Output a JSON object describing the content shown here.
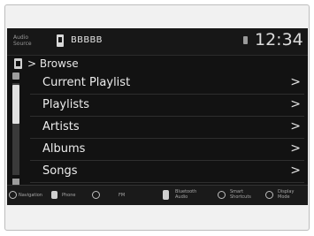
{
  "status": {
    "audio_source_label": "Audio Source",
    "device_name": "BBBBB",
    "clock": "12:34"
  },
  "breadcrumb": {
    "separator": ">",
    "label": "Browse"
  },
  "list": {
    "items": [
      {
        "label": "Current Playlist"
      },
      {
        "label": "Playlists"
      },
      {
        "label": "Artists"
      },
      {
        "label": "Albums"
      },
      {
        "label": "Songs"
      }
    ],
    "chevron": ">"
  },
  "bottom_bar": {
    "items": [
      {
        "label": "Navigation",
        "icon": "navigation-icon"
      },
      {
        "label": "Phone",
        "icon": "phone-icon"
      },
      {
        "label": "",
        "icon": "radio-icon"
      },
      {
        "label": "FM",
        "icon": "fm-icon"
      },
      {
        "label": "Bluetooth Audio",
        "icon": "bluetooth-icon"
      },
      {
        "label": "Smart Shortcuts",
        "icon": "shortcuts-icon"
      },
      {
        "label": "Display Mode",
        "icon": "display-mode-icon"
      }
    ]
  }
}
